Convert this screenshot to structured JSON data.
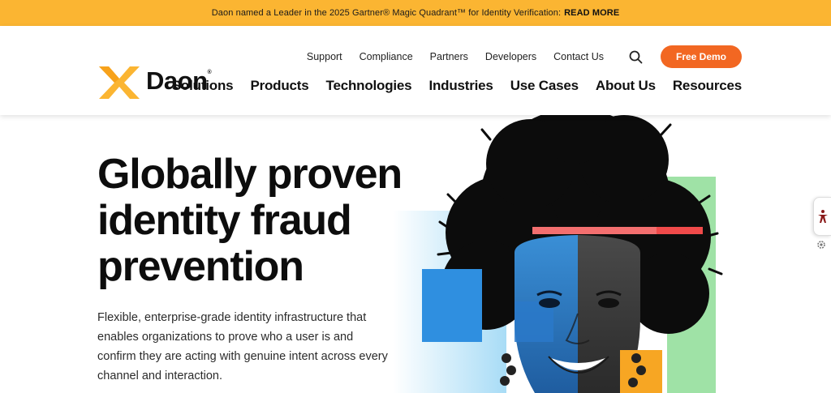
{
  "announcement": {
    "text": "Daon named a Leader in the 2025 Gartner® Magic Quadrant™ for Identity Verification:",
    "link": "READ MORE"
  },
  "brand": {
    "name": "Daon",
    "registered": "®",
    "accent": "#fbb532",
    "cta_color": "#f26722"
  },
  "utility_nav": [
    {
      "label": "Support"
    },
    {
      "label": "Compliance"
    },
    {
      "label": "Partners"
    },
    {
      "label": "Developers"
    },
    {
      "label": "Contact Us"
    }
  ],
  "search": {
    "icon": "search-icon"
  },
  "cta": {
    "label": "Free Demo"
  },
  "main_nav": [
    {
      "label": "Solutions"
    },
    {
      "label": "Products"
    },
    {
      "label": "Technologies"
    },
    {
      "label": "Industries"
    },
    {
      "label": "Use Cases"
    },
    {
      "label": "About Us"
    },
    {
      "label": "Resources"
    }
  ],
  "hero": {
    "title_lines": [
      "Globally proven",
      "identity fraud",
      "prevention"
    ],
    "body": "Flexible, enterprise-grade identity infrastructure that enables organizations to prove who a user is and confirm they are acting with genuine intent across every channel and interaction."
  },
  "side_widget": {
    "icon": "accessibility-icon",
    "settings_icon": "gear-icon"
  }
}
